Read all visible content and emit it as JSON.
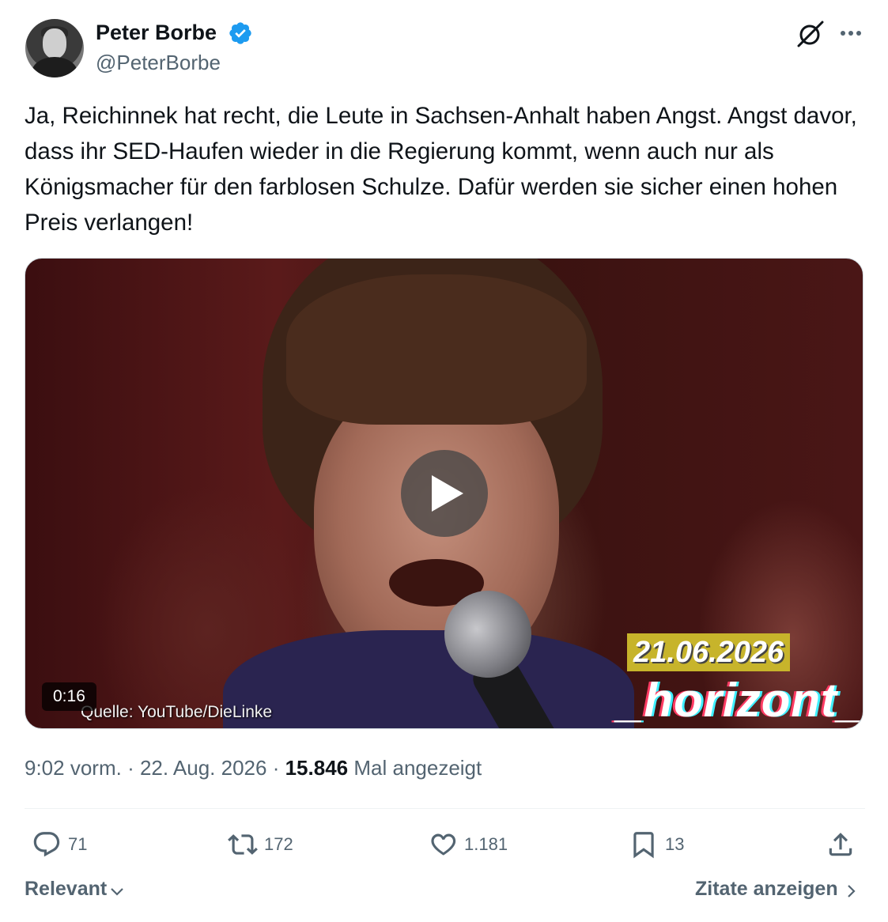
{
  "author": {
    "name": "Peter Borbe",
    "handle": "@PeterBorbe",
    "verified": true
  },
  "tweet": {
    "text": "Ja, Reichinnek hat recht, die Leute in Sachsen-Anhalt haben Angst. Angst davor, dass ihr SED-Haufen wieder in die Regierung kommt, wenn auch nur als Königsmacher für den farblosen Schulze. Dafür werden sie sicher einen hohen Preis verlangen!"
  },
  "video": {
    "duration": "0:16",
    "source_caption": "Quelle: YouTube/DieLinke",
    "date_overlay": "21.06.2026",
    "brand_overlay": "_horizont_"
  },
  "meta": {
    "time": "9:02 vorm.",
    "separator": "·",
    "date": "22. Aug. 2026",
    "views_count": "15.846",
    "views_label": "Mal angezeigt"
  },
  "actions": {
    "replies": "71",
    "reposts": "172",
    "likes": "1.181",
    "bookmarks": "13"
  },
  "footer": {
    "sort_label": "Relevant",
    "quotes_label": "Zitate anzeigen"
  },
  "colors": {
    "text": "#0f1419",
    "secondary": "#536471",
    "verified": "#1d9bf0",
    "divider": "#eff3f4"
  },
  "icons": [
    "verified-badge-icon",
    "grok-icon",
    "more-icon",
    "play-icon",
    "reply-icon",
    "repost-icon",
    "like-icon",
    "bookmark-icon",
    "share-icon",
    "chevron-down-icon",
    "chevron-right-icon"
  ]
}
